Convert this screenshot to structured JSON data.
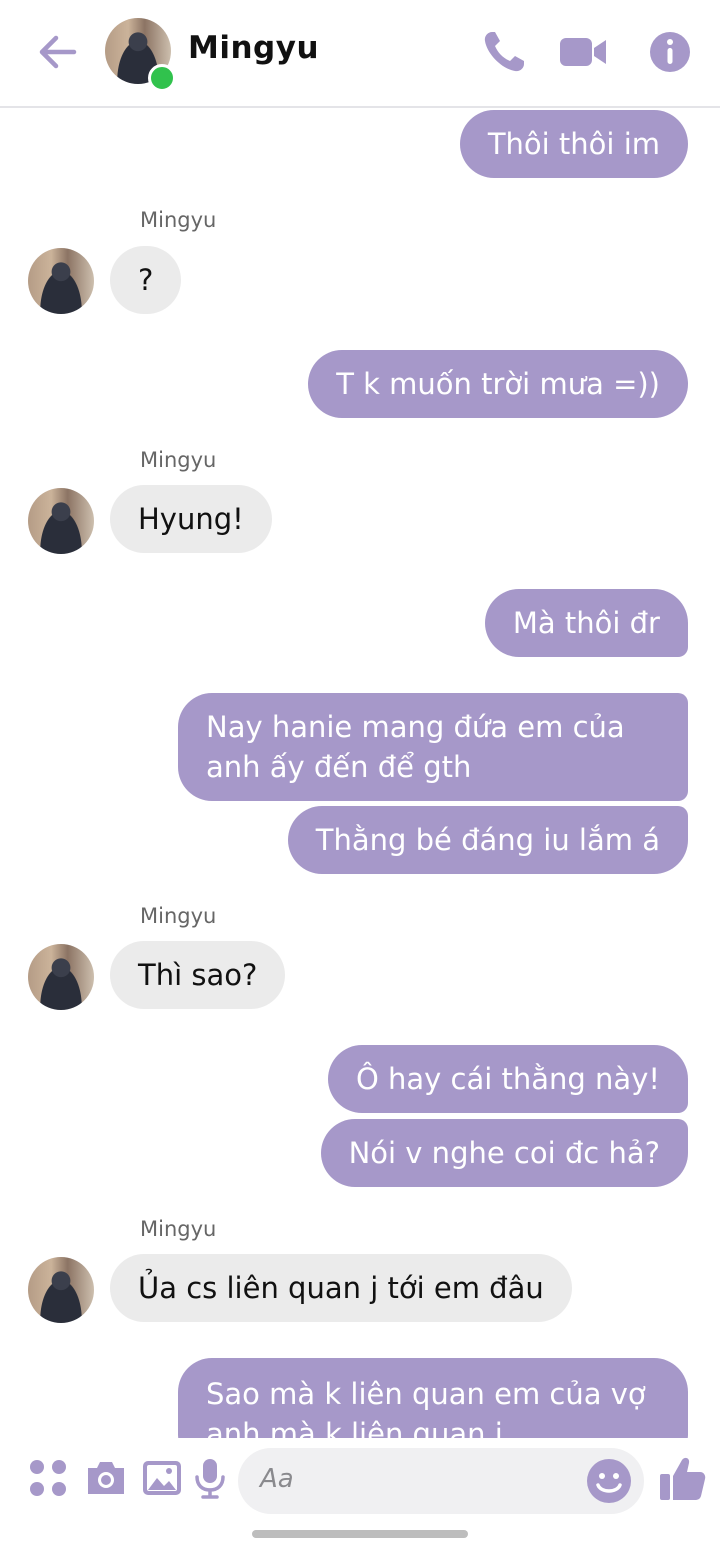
{
  "contact": {
    "name": "Mingyu"
  },
  "colors": {
    "accent": "#a698c9",
    "incoming_bubble": "#ebebeb",
    "online": "#31c24d"
  },
  "header_icons": [
    "back-arrow-icon",
    "phone-icon",
    "video-camera-icon",
    "info-icon"
  ],
  "messages": [
    {
      "dir": "out",
      "text": "Thôi thôi im"
    },
    {
      "dir": "in",
      "sender": "Mingyu",
      "text": "?"
    },
    {
      "dir": "out",
      "text": "T k muốn trời mưa =))"
    },
    {
      "dir": "in",
      "sender": "Mingyu",
      "text": "Hyung!"
    },
    {
      "dir": "out",
      "text": "Mà thôi đr"
    },
    {
      "dir": "out",
      "text": "Nay hanie mang đứa em của anh ấy đến để gth"
    },
    {
      "dir": "out",
      "text": "Thằng bé đáng iu lắm á"
    },
    {
      "dir": "in",
      "sender": "Mingyu",
      "text": "Thì sao?"
    },
    {
      "dir": "out",
      "text": "Ô hay cái thằng này!"
    },
    {
      "dir": "out",
      "text": "Nói v nghe coi đc hả?"
    },
    {
      "dir": "in",
      "sender": "Mingyu",
      "text": "Ủa cs liên quan j tới em đâu"
    },
    {
      "dir": "out",
      "text": "Sao mà k liên quan em của vợ anh mà k liên quan j"
    }
  ],
  "composer": {
    "placeholder": "Aa",
    "icons": [
      "apps-icon",
      "camera-icon",
      "gallery-icon",
      "microphone-icon",
      "emoji-icon",
      "thumbs-up-icon"
    ]
  }
}
